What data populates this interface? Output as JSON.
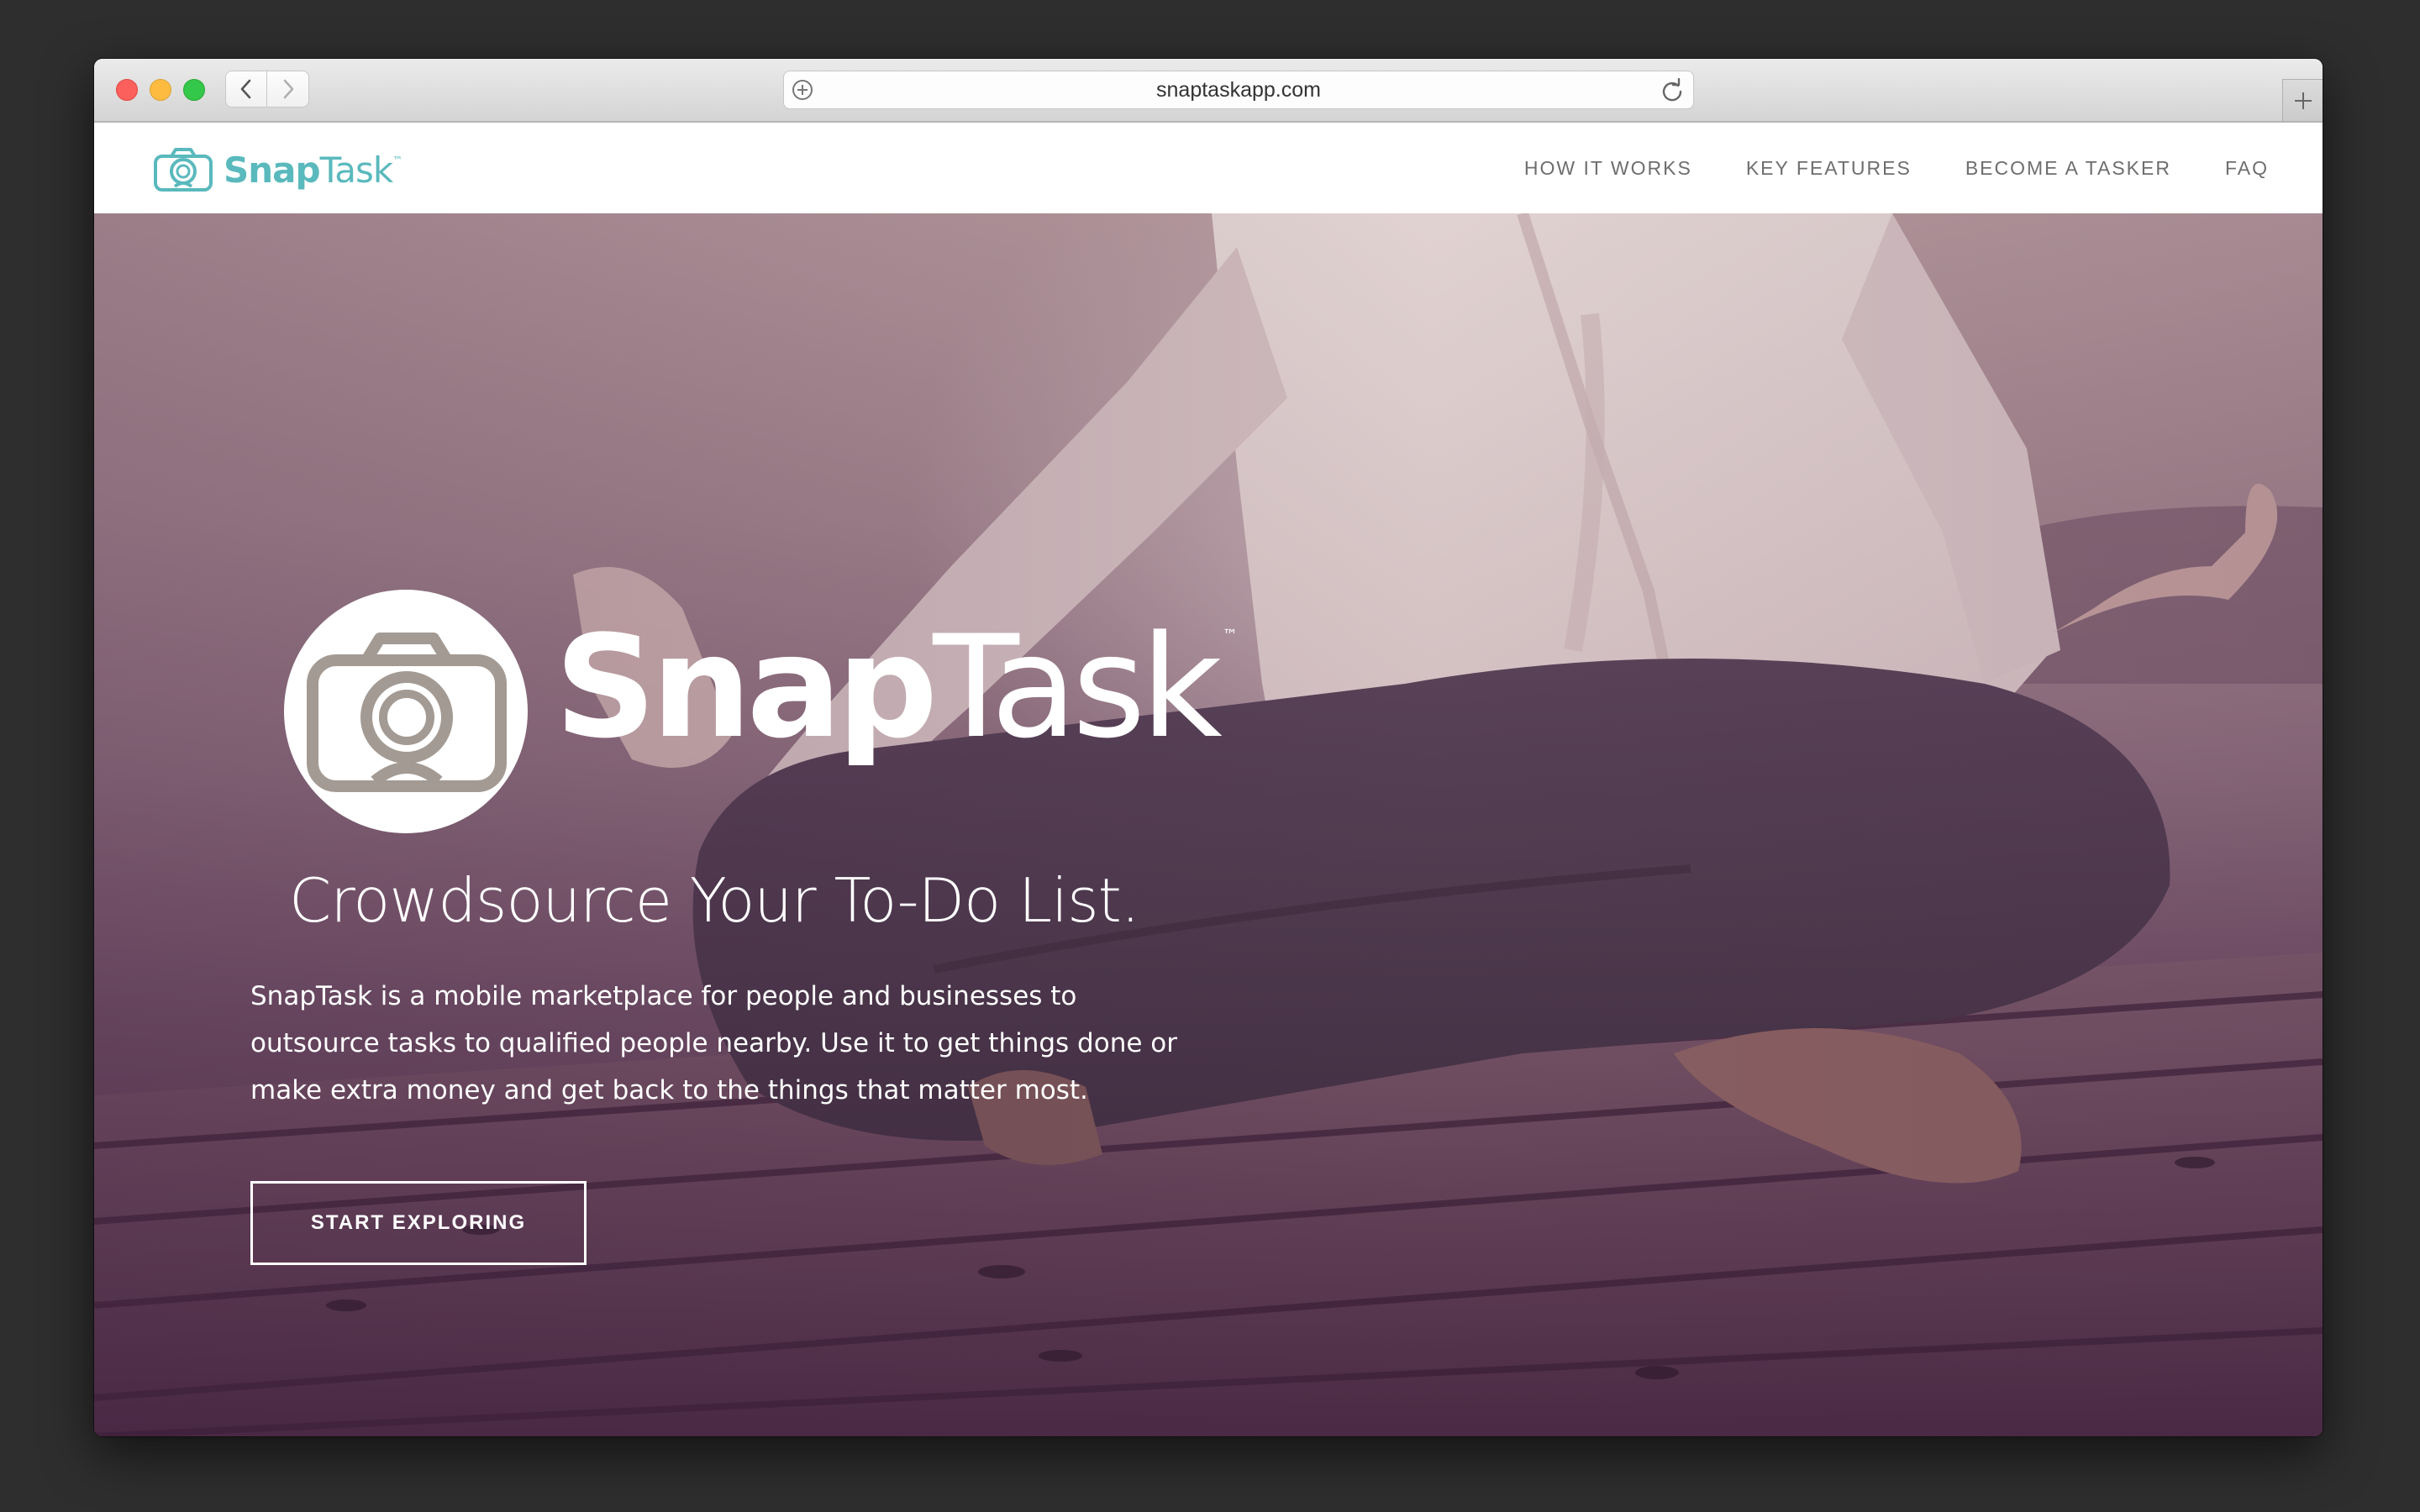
{
  "browser": {
    "url": "snaptaskapp.com",
    "icons": {
      "back": "chevron-left-icon",
      "forward": "chevron-right-icon",
      "add": "plus-circle-icon",
      "reload": "reload-icon",
      "new_tab": "plus-icon"
    }
  },
  "header": {
    "brand_bold": "Snap",
    "brand_light": "Task",
    "brand_tm": "™",
    "nav": [
      {
        "label": "HOW IT WORKS"
      },
      {
        "label": "KEY FEATURES"
      },
      {
        "label": "BECOME A TASKER"
      },
      {
        "label": "FAQ"
      }
    ]
  },
  "hero": {
    "brand_bold": "Snap",
    "brand_light": "Task",
    "brand_tm": "™",
    "tagline": "Crowdsource Your To-Do List.",
    "description": "SnapTask is a mobile marketplace for people and businesses to outsource tasks to qualified people nearby. Use it to get things done or make extra money and get back to the things that matter most.",
    "cta_label": "START EXPLORING"
  },
  "colors": {
    "brand_teal": "#5ab9bd",
    "nav_text": "#6e6e6e",
    "hero_tint": "#58374f",
    "logo_icon": "#a39a93"
  }
}
